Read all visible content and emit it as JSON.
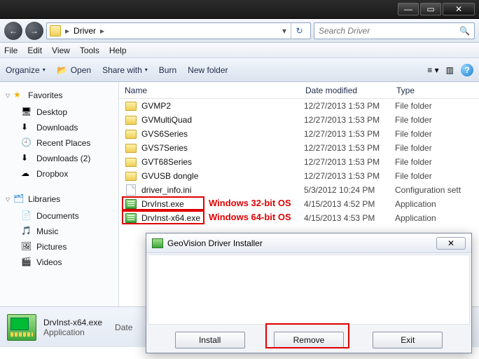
{
  "titlebar": {
    "min": "—",
    "max": "▭",
    "close": "✕"
  },
  "nav": {
    "back": "←",
    "fwd": "→",
    "location": "Driver",
    "sep": "▸",
    "refresh": "↻"
  },
  "search": {
    "placeholder": "Search Driver",
    "icon": "🔍"
  },
  "menu": {
    "file": "File",
    "edit": "Edit",
    "view": "View",
    "tools": "Tools",
    "help": "Help"
  },
  "toolbar": {
    "organize": "Organize",
    "open": "Open",
    "share": "Share with",
    "burn": "Burn",
    "newfolder": "New folder",
    "drop": "▾"
  },
  "sidebar": {
    "favorites": "Favorites",
    "fav_items": [
      {
        "icon": "🖥",
        "label": "Desktop"
      },
      {
        "icon": "⬇",
        "label": "Downloads"
      },
      {
        "icon": "🕘",
        "label": "Recent Places"
      },
      {
        "icon": "⬇",
        "label": "Downloads (2)"
      },
      {
        "icon": "☁",
        "label": "Dropbox"
      }
    ],
    "libraries": "Libraries",
    "lib_items": [
      {
        "icon": "📄",
        "label": "Documents"
      },
      {
        "icon": "🎵",
        "label": "Music"
      },
      {
        "icon": "🖼",
        "label": "Pictures"
      },
      {
        "icon": "🎬",
        "label": "Videos"
      }
    ]
  },
  "columns": {
    "name": "Name",
    "date": "Date modified",
    "type": "Type"
  },
  "files": [
    {
      "kind": "folder",
      "name": "GVMP2",
      "date": "12/27/2013 1:53 PM",
      "type": "File folder"
    },
    {
      "kind": "folder",
      "name": "GVMultiQuad",
      "date": "12/27/2013 1:53 PM",
      "type": "File folder"
    },
    {
      "kind": "folder",
      "name": "GVS6Series",
      "date": "12/27/2013 1:53 PM",
      "type": "File folder"
    },
    {
      "kind": "folder",
      "name": "GVS7Series",
      "date": "12/27/2013 1:53 PM",
      "type": "File folder"
    },
    {
      "kind": "folder",
      "name": "GVT68Series",
      "date": "12/27/2013 1:53 PM",
      "type": "File folder"
    },
    {
      "kind": "folder",
      "name": "GVUSB dongle",
      "date": "12/27/2013 1:53 PM",
      "type": "File folder"
    },
    {
      "kind": "file",
      "name": "driver_info.ini",
      "date": "5/3/2012 10:24 PM",
      "type": "Configuration sett"
    },
    {
      "kind": "exe",
      "name": "DrvInst.exe",
      "date": "4/15/2013 4:52 PM",
      "type": "Application"
    },
    {
      "kind": "exe",
      "name": "DrvInst-x64.exe",
      "date": "4/15/2013 4:53 PM",
      "type": "Application"
    }
  ],
  "annotations": {
    "os32": "Windows 32-bit OS",
    "os64": "Windows 64-bit OS"
  },
  "details": {
    "name": "DrvInst-x64.exe",
    "type": "Application",
    "datelabel": "Date"
  },
  "dialog": {
    "title": "GeoVision Driver Installer",
    "close": "✕",
    "install": "Install",
    "remove": "Remove",
    "exit": "Exit"
  }
}
